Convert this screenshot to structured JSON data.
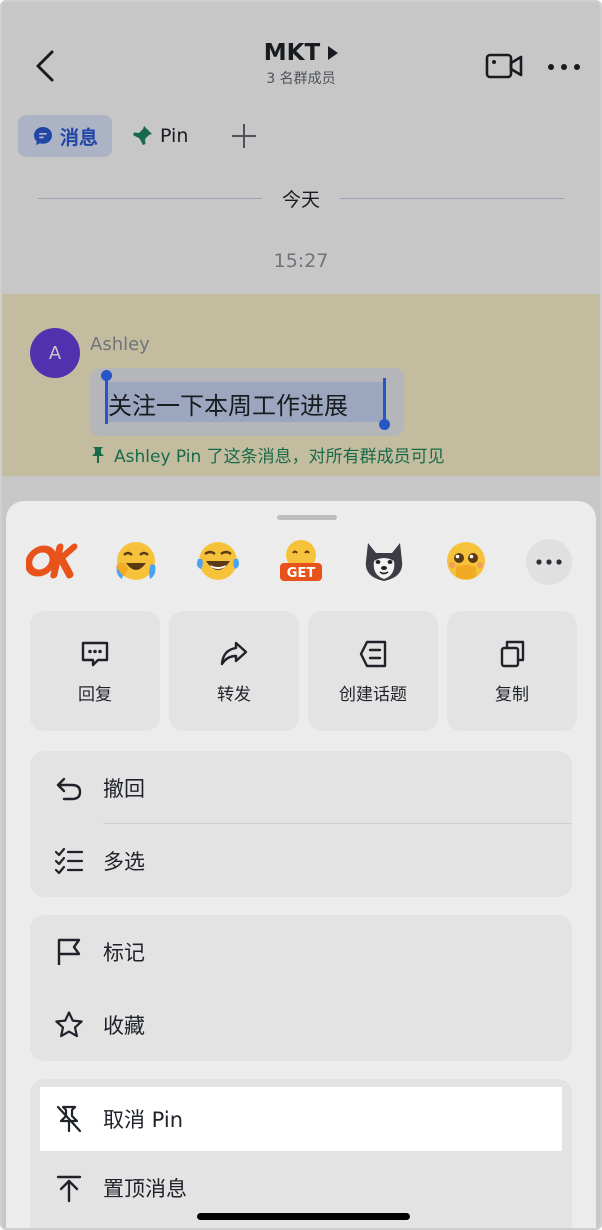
{
  "nav": {
    "title": "MKT",
    "subtitle": "3 名群成员"
  },
  "tabs": {
    "messages": "消息",
    "pin": "Pin"
  },
  "chat": {
    "date_divider": "今天",
    "time": "15:27",
    "message": {
      "avatar_initial": "A",
      "sender": "Ashley",
      "text": "关注一下本周工作进展",
      "pin_note": "Ashley Pin 了这条消息，对所有群成员可见"
    }
  },
  "reactions": [
    {
      "name": "ok-emoji"
    },
    {
      "name": "crying-laughing-emoji"
    },
    {
      "name": "laughing-tears-emoji"
    },
    {
      "name": "get-emoji",
      "label": "GET"
    },
    {
      "name": "husky-dog-emoji"
    },
    {
      "name": "pleading-emoji"
    }
  ],
  "quick_actions": {
    "reply": "回复",
    "forward": "转发",
    "create_topic": "创建话题",
    "copy": "复制"
  },
  "menu": {
    "recall": "撤回",
    "multi_select": "多选",
    "mark": "标记",
    "favorite": "收藏",
    "unpin": "取消 Pin",
    "pin_to_top": "置顶消息"
  },
  "colors": {
    "accent_blue": "#3370ff",
    "pin_green": "#1f8a5f",
    "avatar_purple": "#6a3fe0",
    "pinned_band": "#fbf1cc"
  }
}
